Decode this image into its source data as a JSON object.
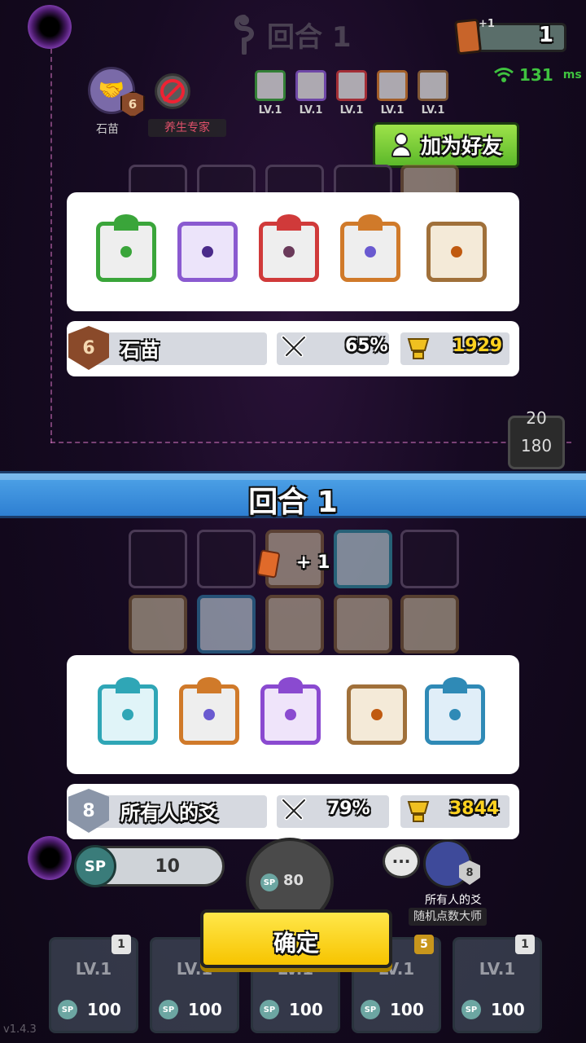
{
  "top": {
    "round_label": "回合 1",
    "card_plus": "+1",
    "card_count": "1",
    "ping_value": "131",
    "ping_unit": "ms"
  },
  "opponent": {
    "rank": "6",
    "name": "石苗",
    "title": "养生专家",
    "add_friend_label": "加为好友",
    "deck_levels": [
      "LV.1",
      "LV.1",
      "LV.1",
      "LV.1",
      "LV.1"
    ],
    "deck_colors": [
      "#3aa53a",
      "#8a5ad0",
      "#d03a3a",
      "#d07a2a",
      "#a0703a"
    ],
    "winrate": "65%",
    "trophies": "1929"
  },
  "timer": {
    "top": "20",
    "bottom": "180"
  },
  "banner": {
    "label": "回合 1"
  },
  "player": {
    "float_text": "+ 1",
    "rank": "8",
    "name": "所有人的爻",
    "deck_colors": [
      "#2fa6b6",
      "#d07a2a",
      "#8a4ad0",
      "#a0703a",
      "#2f8ab6"
    ],
    "winrate": "79%",
    "trophies": "3844",
    "sp": "10",
    "roll_cost": "80",
    "chat_icon": "···",
    "name_small": "所有人的爻",
    "title_small": "随机点数大师"
  },
  "confirm_label": "确定",
  "deck": [
    {
      "level": "LV.1",
      "badge": "1",
      "cost": "100",
      "sp": "SP"
    },
    {
      "level": "LV.1",
      "badge": "",
      "cost": "100",
      "sp": "SP"
    },
    {
      "level": "LV.1",
      "badge": "",
      "cost": "100",
      "sp": "SP"
    },
    {
      "level": "LV.1",
      "badge": "5",
      "cost": "100",
      "sp": "SP"
    },
    {
      "level": "LV.1",
      "badge": "1",
      "cost": "100",
      "sp": "SP"
    }
  ],
  "sp_label": "SP",
  "version": "v1.4.3"
}
